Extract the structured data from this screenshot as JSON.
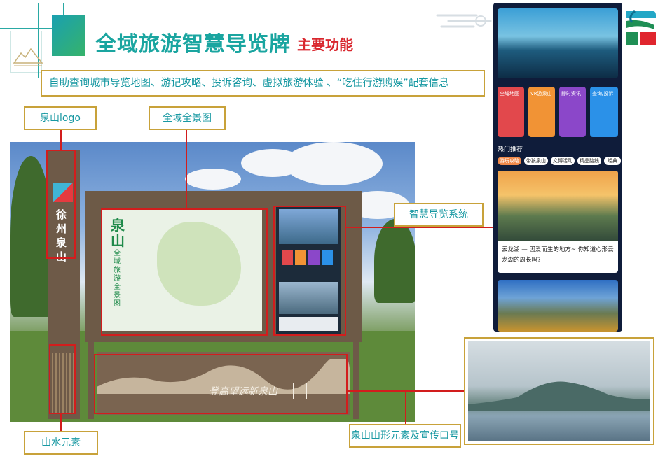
{
  "header": {
    "title": "全域旅游智慧导览牌",
    "subtitle": "主要功能",
    "description": "自助查询城市导览地图、游记攻略、投诉咨询、虚拟旅游体验 、“吃住行游购娱”配套信息"
  },
  "labels": {
    "logo": "泉山logo",
    "panorama": "全域全景图",
    "smart_guide": "智慧导览系统",
    "landscape": "山水元素",
    "slogan": "泉山山形元素及宣传口号"
  },
  "sign": {
    "post_text": "徐州泉山",
    "map_title": "泉山",
    "map_subtitle": "全域旅游全景图",
    "slogan_text": "登高望远新泉山"
  },
  "phone": {
    "tiles": [
      {
        "label": "全域地图",
        "color": "#e2484c"
      },
      {
        "label": "VR游泉山",
        "color": "#f19335"
      },
      {
        "label": "即时资讯",
        "color": "#8b47c9"
      },
      {
        "label": "查询/投诉",
        "color": "#2b91e8"
      }
    ],
    "section_title": "热门推荐",
    "chips": [
      "游玩攻略",
      "带孩泉山",
      "文博活动",
      "精品路线",
      "经典"
    ],
    "card_title": "云龙湖 — 因爱而生的地方~ 你知道心形云龙湖的周长吗?"
  },
  "colors": {
    "accent_teal": "#1aa5a0",
    "accent_red": "#d9272e",
    "frame_gold": "#c8a23a",
    "callout_red": "#d21d1d"
  }
}
